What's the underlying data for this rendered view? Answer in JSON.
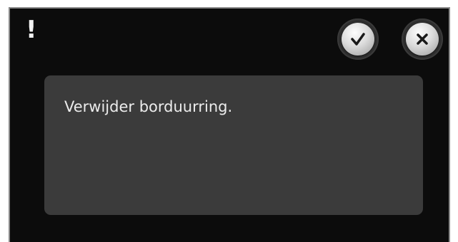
{
  "dialog": {
    "alert_icon": "!",
    "confirm_button": {
      "icon": "checkmark-icon"
    },
    "cancel_button": {
      "icon": "close-icon"
    },
    "message": "Verwijder borduurring."
  },
  "colors": {
    "background": "#0c0c0c",
    "panel": "#3b3b3b",
    "text": "#ececec"
  }
}
